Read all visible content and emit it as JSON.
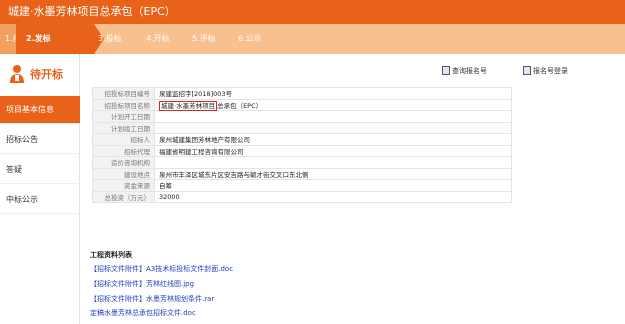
{
  "titlebar": {
    "title": "城建·水墨芳林项目总承包（EPC）"
  },
  "steps": [
    {
      "label": "1.招标"
    },
    {
      "label": "2.发标"
    },
    {
      "label": "3.投标"
    },
    {
      "label": "4.开标"
    },
    {
      "label": "5.评标"
    },
    {
      "label": "6.公示"
    }
  ],
  "sidebar": {
    "title": "待开标",
    "items": [
      {
        "label": "项目基本信息"
      },
      {
        "label": "招标公告"
      },
      {
        "label": "答疑"
      },
      {
        "label": "中标公示"
      }
    ]
  },
  "actions": {
    "query": "查询报名号",
    "register": "报名号登录"
  },
  "info": {
    "rows": [
      {
        "label": "招投标项目编号",
        "value": "泉建监招字[2018]003号"
      },
      {
        "label": "招投标项目名称",
        "value_hl": "城建·水墨芳林项目",
        "value_rest": "总承包（EPC）"
      },
      {
        "label": "计划开工日期",
        "value": ""
      },
      {
        "label": "计划竣工日期",
        "value": ""
      },
      {
        "label": "招标人",
        "value": "泉州城建集团芳林地产有限公司"
      },
      {
        "label": "招标代理",
        "value": "福建省明建工程咨询有限公司"
      },
      {
        "label": "造价咨询机构",
        "value": ""
      },
      {
        "label": "建设地点",
        "value": "泉州市丰泽区城东片区安吉路与毓才街交叉口东北侧"
      },
      {
        "label": "资金来源",
        "value": "自筹"
      },
      {
        "label": "总投资（万元）",
        "value": "32000"
      }
    ]
  },
  "files": {
    "title": "工程资料列表",
    "items": [
      {
        "tag": "【招标文件附件】",
        "name": "A3技术标投标文件封面.doc"
      },
      {
        "tag": "【招标文件附件】",
        "name": "芳林红线图.jpg"
      },
      {
        "tag": "【招标文件附件】",
        "name": "水墨芳林规划条件.rar"
      },
      {
        "tag": "",
        "name": "定稿水墨芳林总承包招标文件.doc"
      }
    ]
  }
}
